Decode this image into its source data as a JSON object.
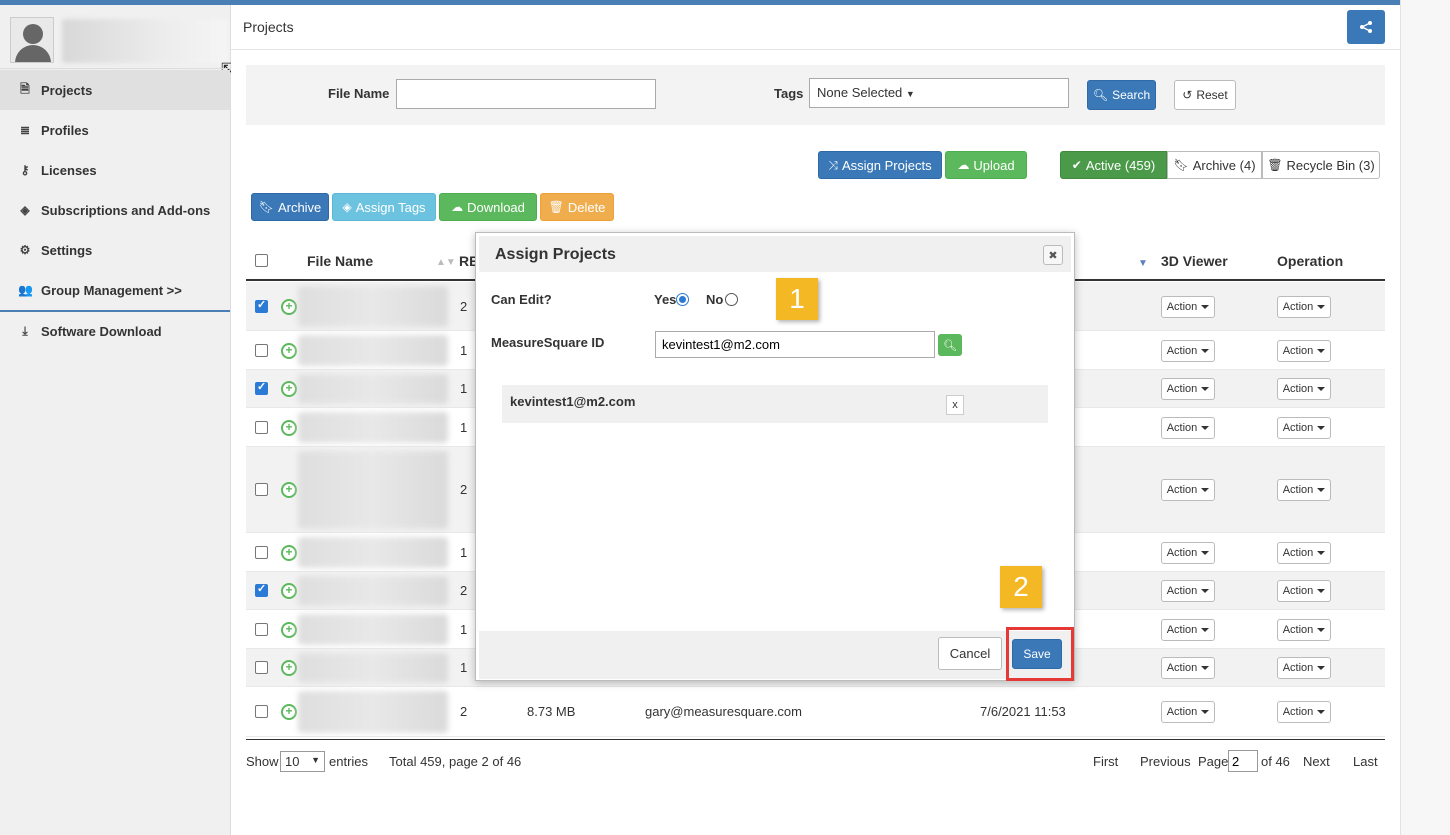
{
  "sidebar": {
    "items": [
      {
        "label": "Projects",
        "icon": "file-icon"
      },
      {
        "label": "Profiles",
        "icon": "database-icon"
      },
      {
        "label": "Licenses",
        "icon": "key-icon"
      },
      {
        "label": "Subscriptions and Add-ons",
        "icon": "tags-icon"
      },
      {
        "label": "Settings",
        "icon": "gear-icon"
      },
      {
        "label": "Group Management >>",
        "icon": "users-icon"
      }
    ],
    "download": {
      "label": "Software Download",
      "icon": "download-icon"
    }
  },
  "header": {
    "title": "Projects"
  },
  "filter": {
    "file_name_label": "File Name",
    "file_name_value": "",
    "tags_label": "Tags",
    "tags_value": "None Selected",
    "search_label": "Search",
    "reset_label": "Reset"
  },
  "toolbar": {
    "assign_projects": "Assign Projects",
    "upload": "Upload",
    "active": "Active (459)",
    "archive_tab": "Archive (4)",
    "recycle": "Recycle Bin (3)",
    "archive": "Archive",
    "assign_tags": "Assign Tags",
    "download": "Download",
    "delete": "Delete"
  },
  "table": {
    "headers": {
      "file_name": "File Name",
      "rev": "RE",
      "viewer": "3D Viewer",
      "operation": "Operation"
    },
    "action_label": "Action",
    "rows": [
      {
        "checked": true,
        "rev": "2"
      },
      {
        "checked": false,
        "rev": "1"
      },
      {
        "checked": true,
        "rev": "1"
      },
      {
        "checked": false,
        "rev": "1"
      },
      {
        "checked": false,
        "rev": "2"
      },
      {
        "checked": false,
        "rev": "1"
      },
      {
        "checked": true,
        "rev": "2"
      },
      {
        "checked": false,
        "rev": "1"
      },
      {
        "checked": false,
        "rev": "1"
      },
      {
        "checked": false,
        "rev": "2",
        "size": "8.73 MB",
        "owner": "gary@measuresquare.com",
        "date": "7/6/2021 11:53"
      }
    ]
  },
  "pagination": {
    "show": "Show",
    "entries_value": "10",
    "entries": "entries",
    "total": "Total 459, page 2 of 46",
    "first": "First",
    "previous": "Previous",
    "page": "Page",
    "page_value": "2",
    "of": "of 46",
    "next": "Next",
    "last": "Last"
  },
  "modal": {
    "title": "Assign Projects",
    "can_edit_label": "Can Edit?",
    "yes": "Yes",
    "no": "No",
    "can_edit_value": "Yes",
    "ms_id_label": "MeasureSquare ID",
    "ms_id_value": "kevintest1@m2.com",
    "assigned_email": "kevintest1@m2.com",
    "remove": "x",
    "cancel": "Cancel",
    "save": "Save"
  },
  "callouts": [
    "1",
    "2"
  ],
  "colors": {
    "primary": "#3a78b8",
    "success": "#5cb85c",
    "callout": "#f4b825",
    "highlight": "#e53935"
  }
}
